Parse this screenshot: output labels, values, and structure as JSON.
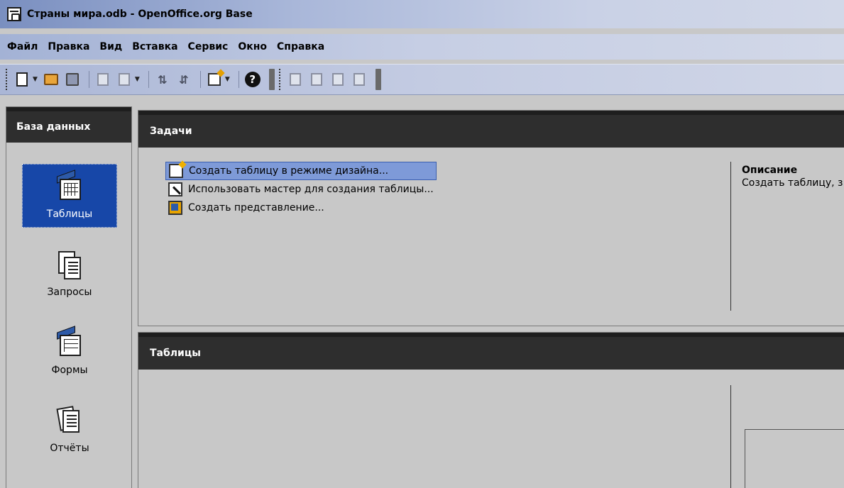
{
  "window": {
    "title": "Страны мира.odb - OpenOffice.org Base"
  },
  "menu": [
    {
      "label": "Файл"
    },
    {
      "label": "Правка"
    },
    {
      "label": "Вид"
    },
    {
      "label": "Вставка"
    },
    {
      "label": "Сервис"
    },
    {
      "label": "Окно"
    },
    {
      "label": "Справка"
    }
  ],
  "toolbar": {
    "buttons": [
      "new-document-icon",
      "open-folder-icon",
      "save-icon",
      "copy-icon",
      "paste-icon",
      "sort-ascending-icon",
      "sort-descending-icon",
      "form-icon",
      "help-icon",
      "open-db-object-icon",
      "edit-icon",
      "delete-icon",
      "rename-icon"
    ]
  },
  "sidebar": {
    "header": "База данных",
    "items": [
      {
        "label": "Таблицы",
        "selected": true
      },
      {
        "label": "Запросы",
        "selected": false
      },
      {
        "label": "Формы",
        "selected": false
      },
      {
        "label": "Отчёты",
        "selected": false
      }
    ]
  },
  "tasks": {
    "header": "Задачи",
    "items": [
      {
        "label": "Создать таблицу в режиме дизайна...",
        "active": true
      },
      {
        "label": "Использовать мастер для создания таблицы...",
        "active": false
      },
      {
        "label": "Создать представление...",
        "active": false
      }
    ],
    "description_title": "Описание",
    "description_text": "Создать таблицу, з"
  },
  "tables": {
    "header": "Таблицы"
  },
  "colors": {
    "selection": "#1747a8",
    "header_bg": "#2e2e2e",
    "panel_bg": "#c8c8c8"
  }
}
